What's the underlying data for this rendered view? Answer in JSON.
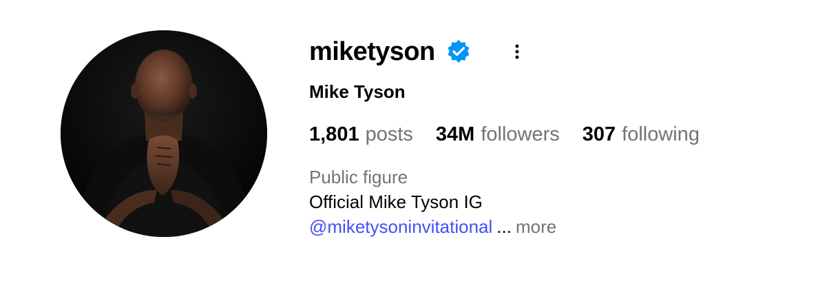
{
  "profile": {
    "username": "miketyson",
    "full_name": "Mike Tyson",
    "verified_icon": "verified-badge-icon",
    "options_icon": "more-vertical-icon",
    "accent_color": "#0095f6",
    "link_color": "#4150f7",
    "secondary_text_color": "#737373"
  },
  "stats": {
    "posts": {
      "count": "1,801",
      "label": "posts"
    },
    "followers": {
      "count": "34M",
      "label": "followers"
    },
    "following": {
      "count": "307",
      "label": "following"
    }
  },
  "bio": {
    "category": "Public figure",
    "text": "Official Mike Tyson IG",
    "mention": "@miketysoninvitational",
    "ellipsis": "...",
    "more_label": "more"
  }
}
